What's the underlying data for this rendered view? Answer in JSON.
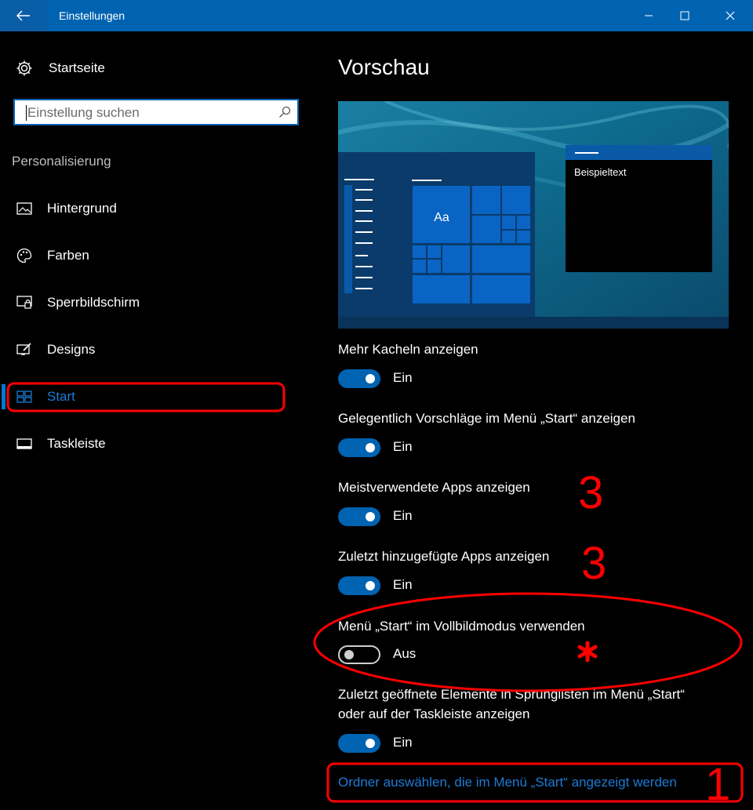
{
  "window": {
    "title": "Einstellungen",
    "back_icon": "back-arrow-icon",
    "controls": [
      "minimize-icon",
      "maximize-icon",
      "close-icon"
    ]
  },
  "sidebar": {
    "home_label": "Startseite",
    "search_placeholder": "Einstellung suchen",
    "section_label": "Personalisierung",
    "items": [
      {
        "label": "Hintergrund",
        "icon": "image-icon"
      },
      {
        "label": "Farben",
        "icon": "palette-icon"
      },
      {
        "label": "Sperrbildschirm",
        "icon": "lockscreen-icon"
      },
      {
        "label": "Designs",
        "icon": "designs-icon"
      },
      {
        "label": "Start",
        "icon": "start-icon",
        "active": true
      },
      {
        "label": "Taskleiste",
        "icon": "taskbar-icon"
      }
    ]
  },
  "main": {
    "title": "Vorschau",
    "preview": {
      "tile_label": "Aa",
      "sample_text": "Beispieltext"
    },
    "settings": [
      {
        "label": "Mehr Kacheln anzeigen",
        "state": "Ein",
        "on": true
      },
      {
        "label": "Gelegentlich Vorschläge im Menü „Start“ anzeigen",
        "state": "Ein",
        "on": true
      },
      {
        "label": "Meistverwendete Apps anzeigen",
        "state": "Ein",
        "on": true
      },
      {
        "label": "Zuletzt hinzugefügte Apps anzeigen",
        "state": "Ein",
        "on": true
      },
      {
        "label": "Menü „Start“ im Vollbildmodus verwenden",
        "state": "Aus",
        "on": false
      },
      {
        "label_line1": "Zuletzt geöffnete Elemente in Sprunglisten im Menü „Start“",
        "label_line2": "oder auf der Taskleiste anzeigen",
        "state": "Ein",
        "on": true
      }
    ],
    "link": "Ordner auswählen, die im Menü „Start“ angezeigt werden"
  },
  "annotations": {
    "num_a": "3",
    "num_b": "3",
    "star": "*",
    "num_c": "1",
    "color": "#ff0000"
  },
  "colors": {
    "accent": "#0063b1",
    "link": "#1d7bd6",
    "background": "#000000"
  }
}
